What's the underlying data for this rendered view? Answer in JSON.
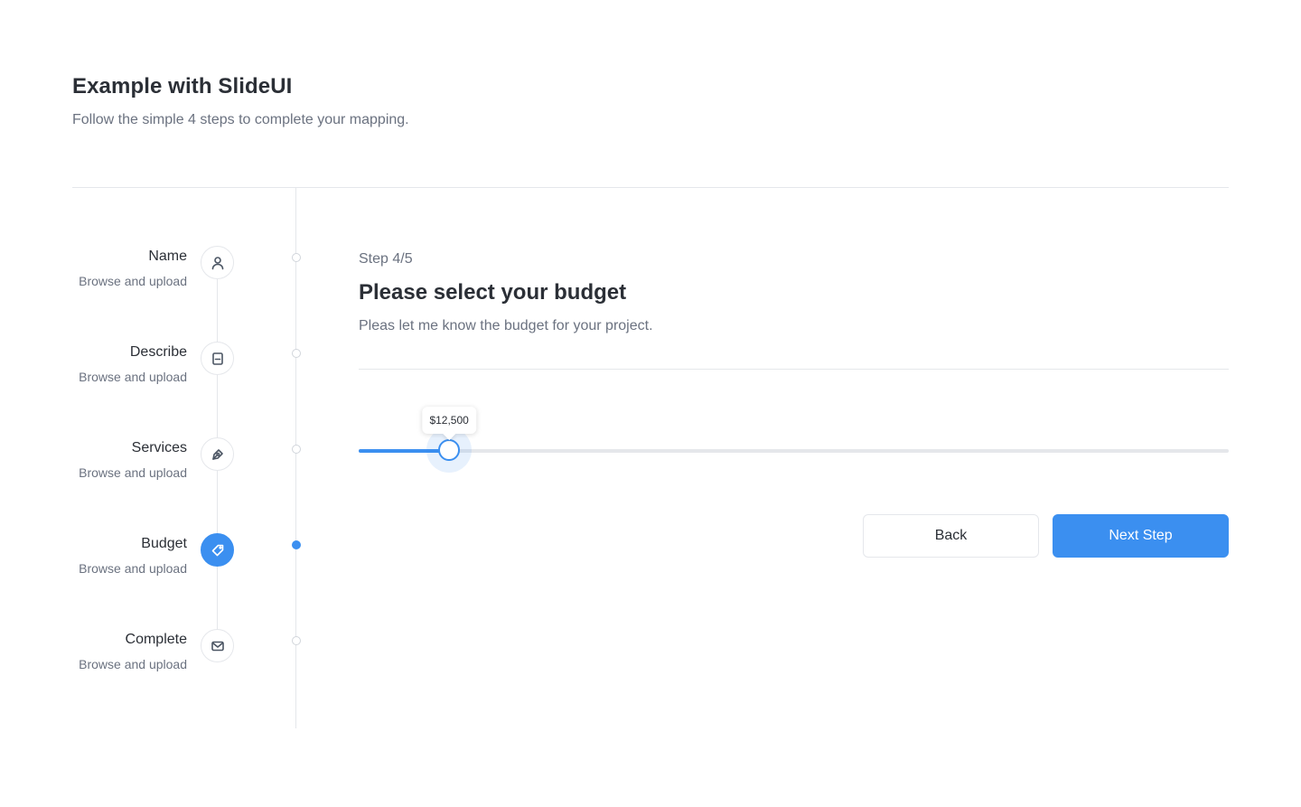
{
  "header": {
    "title": "Example with SlideUI",
    "subtitle": "Follow the simple 4 steps to complete your mapping."
  },
  "steps": [
    {
      "label": "Name",
      "description": "Browse and upload",
      "icon": "user-icon",
      "active": false
    },
    {
      "label": "Describe",
      "description": "Browse and upload",
      "icon": "document-icon",
      "active": false
    },
    {
      "label": "Services",
      "description": "Browse and upload",
      "icon": "pen-tool-icon",
      "active": false
    },
    {
      "label": "Budget",
      "description": "Browse and upload",
      "icon": "tag-icon",
      "active": true
    },
    {
      "label": "Complete",
      "description": "Browse and upload",
      "icon": "mail-icon",
      "active": false
    }
  ],
  "content": {
    "step_counter": "Step 4/5",
    "title": "Please select your budget",
    "description": "Pleas let me know the budget for your project."
  },
  "budget_slider": {
    "value_label": "$12,500",
    "fill_fraction": 0.104
  },
  "buttons": {
    "back_label": "Back",
    "next_label": "Next Step"
  },
  "colors": {
    "accent": "#3b8ff0",
    "border": "#e5e7eb",
    "text_primary": "#2b2f36",
    "text_secondary": "#6b7280"
  }
}
